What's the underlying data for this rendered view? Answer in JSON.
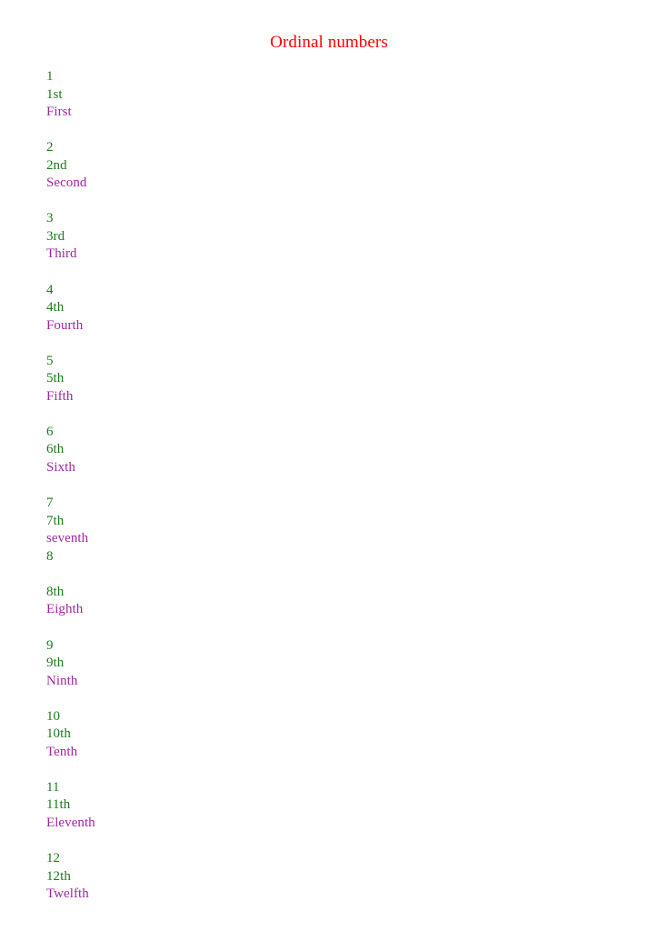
{
  "document": {
    "title": "Ordinal numbers",
    "title_color": "#fe0000",
    "numeral_color": "#1d7a1d",
    "abbreviation_color": "#1d7a1d",
    "word_color": "#a028a0",
    "background_color": "#ffffff"
  },
  "entries": [
    {
      "numeral": "1",
      "abbreviation": "1st",
      "word": "First"
    },
    {
      "numeral": "2",
      "abbreviation": "2nd",
      "word": "Second"
    },
    {
      "numeral": "3",
      "abbreviation": "3rd",
      "word": "Third"
    },
    {
      "numeral": "4",
      "abbreviation": "4th",
      "word": "Fourth"
    },
    {
      "numeral": "5",
      "abbreviation": "5th",
      "word": "Fifth"
    },
    {
      "numeral": "6",
      "abbreviation": "6th",
      "word": "Sixth"
    },
    {
      "numeral": "7",
      "abbreviation": "7th",
      "word": "seventh"
    },
    {
      "numeral": "8",
      "abbreviation": "8th",
      "word": "Eighth"
    },
    {
      "numeral": "9",
      "abbreviation": "9th",
      "word": "Ninth"
    },
    {
      "numeral": "10",
      "abbreviation": "10th",
      "word": "Tenth"
    },
    {
      "numeral": "11",
      "abbreviation": "11th",
      "word": "Eleventh"
    },
    {
      "numeral": "12",
      "abbreviation": "12th",
      "word": "Twelfth"
    }
  ]
}
